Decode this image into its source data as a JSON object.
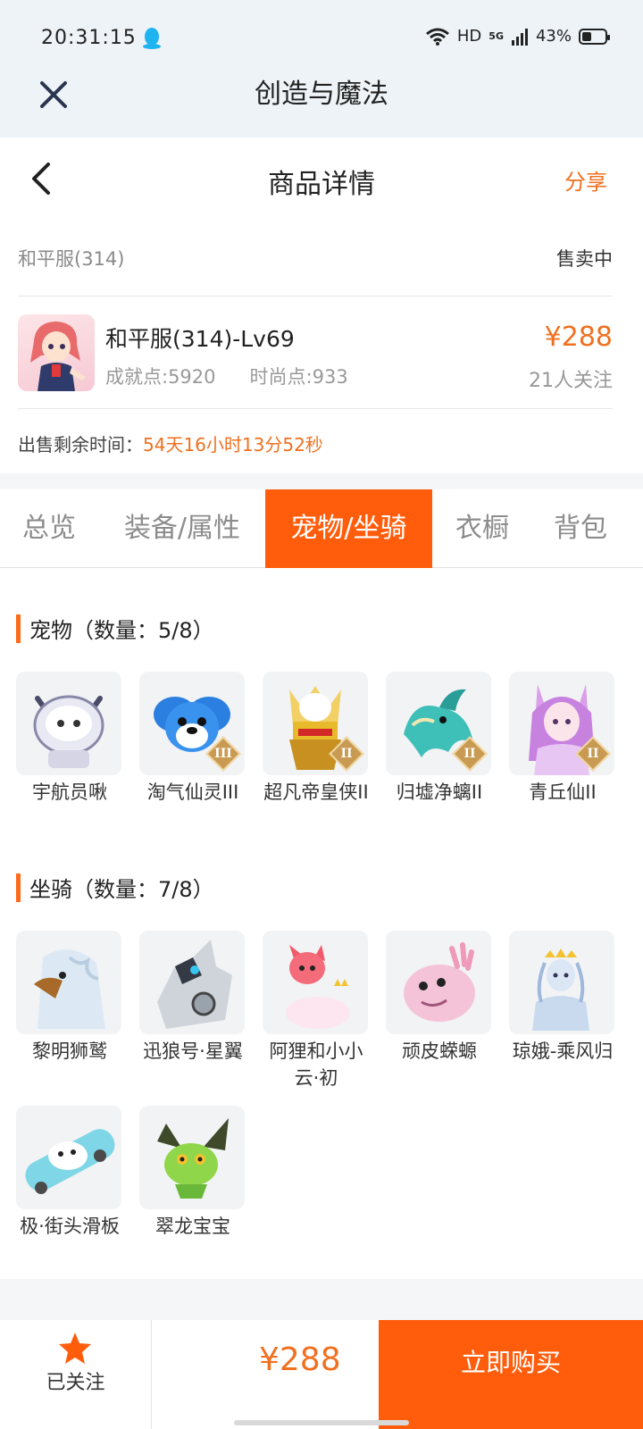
{
  "status": {
    "time": "20:31:15",
    "network": "HD",
    "signal": "5G",
    "battery_text": "43%",
    "battery_level": 0.43
  },
  "app": {
    "title": "创造与魔法"
  },
  "nav": {
    "title": "商品详情",
    "share": "分享"
  },
  "server": {
    "name": "和平服(314)",
    "status": "售卖中"
  },
  "account": {
    "name": "和平服(314)-Lv69",
    "achievement": "成就点:5920",
    "fashion": "时尚点:933",
    "price": "¥288",
    "followers": "21人关注"
  },
  "sale_time": {
    "label": "出售剩余时间：",
    "value": "54天16小时13分52秒"
  },
  "tabs": [
    "总览",
    "装备/属性",
    "宠物/坐骑",
    "衣橱",
    "背包"
  ],
  "active_tab": "宠物/坐骑",
  "pets": {
    "title": "宠物（数量：5/8）",
    "items": [
      {
        "name": "宇航员啾",
        "grade": ""
      },
      {
        "name": "淘气仙灵III",
        "grade": "III"
      },
      {
        "name": "超凡帝皇侠II",
        "grade": "II"
      },
      {
        "name": "归墟净螭II",
        "grade": "II"
      },
      {
        "name": "青丘仙II",
        "grade": "II"
      }
    ]
  },
  "mounts": {
    "title": "坐骑（数量：7/8）",
    "items": [
      {
        "name": "黎明狮鹫"
      },
      {
        "name": "迅狼号·星翼"
      },
      {
        "name": "阿狸和小小云·初"
      },
      {
        "name": "顽皮蝾螈"
      },
      {
        "name": "琼娥-乘风归"
      },
      {
        "name": "极·街头滑板"
      },
      {
        "name": "翠龙宝宝"
      }
    ]
  },
  "bottom": {
    "follow_label": "已关注",
    "price": "¥288",
    "buy": "立即购买"
  },
  "colors": {
    "accent": "#ff5d0c",
    "price": "#f07020"
  }
}
